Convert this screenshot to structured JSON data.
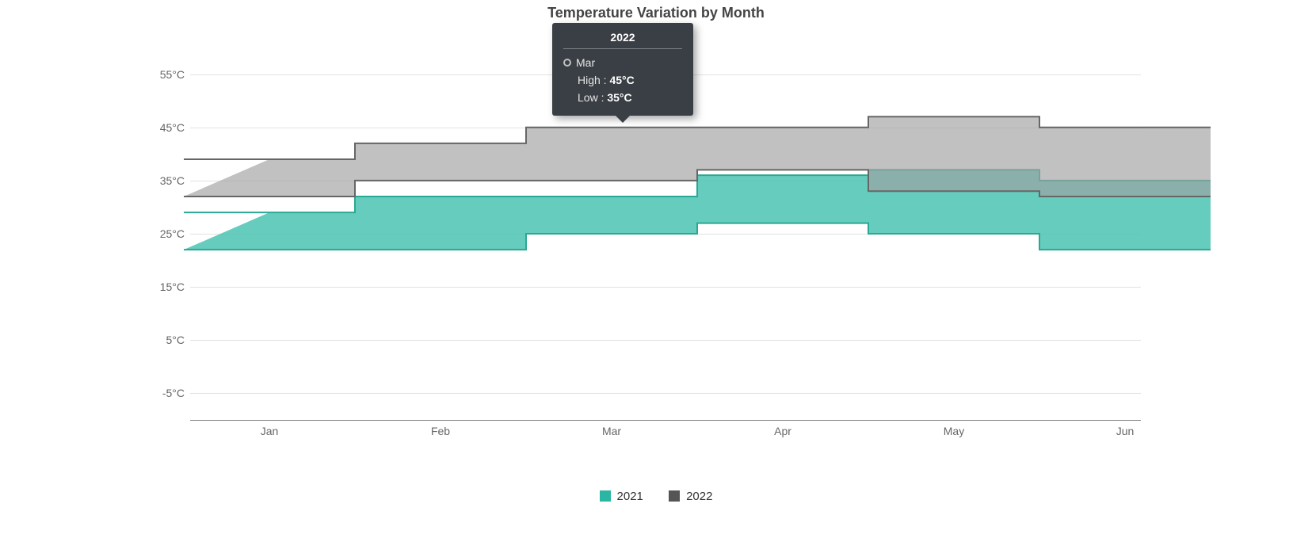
{
  "chart_data": {
    "type": "area",
    "title": "Temperature Variation by Month",
    "categories": [
      "Jan",
      "Feb",
      "Mar",
      "Apr",
      "May",
      "Jun"
    ],
    "xlabel": "",
    "ylabel": "",
    "ylim": [
      -10,
      60
    ],
    "y_ticks": [
      -5,
      5,
      15,
      25,
      35,
      45,
      55
    ],
    "y_tick_labels": [
      "-5°C",
      "5°C",
      "15°C",
      "25°C",
      "35°C",
      "45°C",
      "55°C"
    ],
    "series": [
      {
        "name": "2021",
        "color": "#2bb5a3",
        "high": [
          29,
          32,
          32,
          36,
          37,
          35
        ],
        "low": [
          22,
          22,
          25,
          27,
          25,
          22
        ]
      },
      {
        "name": "2022",
        "color": "#666666",
        "high": [
          39,
          42,
          45,
          45,
          47,
          45
        ],
        "low": [
          32,
          35,
          35,
          37,
          33,
          32
        ]
      }
    ],
    "legend_position": "bottom",
    "grid": true
  },
  "tooltip": {
    "series": "2022",
    "category": "Mar",
    "high_label": "High :",
    "high_value": "45°C",
    "low_label": "Low :",
    "low_value": "35°C"
  },
  "legend": {
    "items": [
      "2021",
      "2022"
    ]
  }
}
